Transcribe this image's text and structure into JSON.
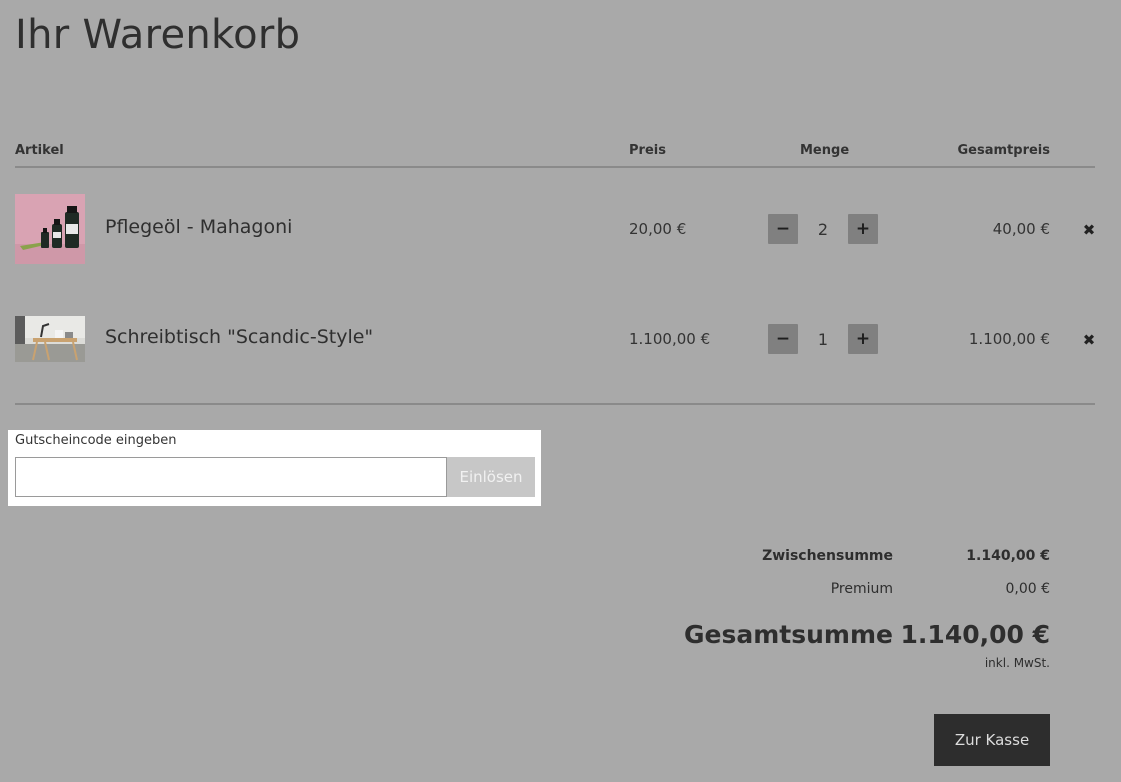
{
  "page": {
    "title": "Ihr Warenkorb"
  },
  "table": {
    "headers": {
      "article": "Artikel",
      "price": "Preis",
      "quantity": "Menge",
      "total": "Gesamtpreis"
    }
  },
  "items": [
    {
      "name": "Pflegeöl - Mahagoni",
      "price": "20,00 €",
      "quantity": "2",
      "total": "40,00 €",
      "minus": "−",
      "plus": "+",
      "remove": "✖"
    },
    {
      "name": "Schreibtisch \"Scandic-Style\"",
      "price": "1.100,00 €",
      "quantity": "1",
      "total": "1.100,00 €",
      "minus": "−",
      "plus": "+",
      "remove": "✖"
    }
  ],
  "voucher": {
    "label": "Gutscheincode eingeben",
    "value": "",
    "placeholder": "",
    "button": "Einlösen"
  },
  "summary": {
    "subtotal_label": "Zwischensumme",
    "subtotal_value": "1.140,00 €",
    "premium_label": "Premium",
    "premium_value": "0,00 €",
    "total_label": "Gesamtsumme",
    "total_value": "1.140,00 €",
    "tax_note": "inkl. MwSt."
  },
  "checkout": {
    "label": "Zur Kasse"
  },
  "colors": {
    "background": "#a9a9a9",
    "checkout_button": "#2d2d2d",
    "qty_button": "#808080"
  }
}
